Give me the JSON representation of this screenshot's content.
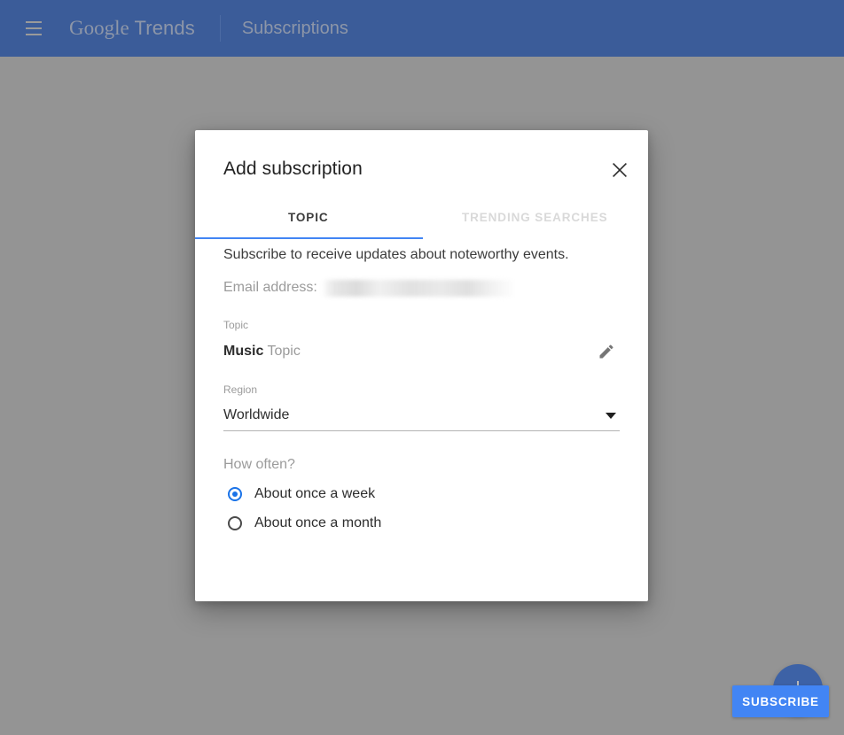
{
  "header": {
    "menu_icon": "hamburger-menu-icon",
    "brand_google": "Google",
    "brand_trends": "Trends",
    "section": "Subscriptions"
  },
  "fab": {
    "icon": "plus-icon",
    "label": "+"
  },
  "dialog": {
    "title": "Add subscription",
    "close_icon": "close-icon",
    "tabs": [
      {
        "label": "TOPIC",
        "active": true
      },
      {
        "label": "TRENDING SEARCHES",
        "active": false
      }
    ],
    "description": "Subscribe to receive updates about noteworthy events.",
    "email": {
      "label": "Email address:",
      "value": ""
    },
    "topic": {
      "label": "Topic",
      "value_strong": "Music",
      "value_suffix": "Topic",
      "edit_icon": "pencil-edit-icon"
    },
    "region": {
      "label": "Region",
      "value": "Worldwide",
      "caret_icon": "chevron-down-icon"
    },
    "frequency": {
      "label": "How often?",
      "options": [
        {
          "label": "About once a week",
          "selected": true
        },
        {
          "label": "About once a month",
          "selected": false
        }
      ]
    },
    "submit_label": "SUBSCRIBE"
  },
  "colors": {
    "header_bar": "#3b5c99",
    "accent_blue": "#4285f4",
    "radio_blue": "#1a73e8",
    "overlay": "#949494"
  }
}
